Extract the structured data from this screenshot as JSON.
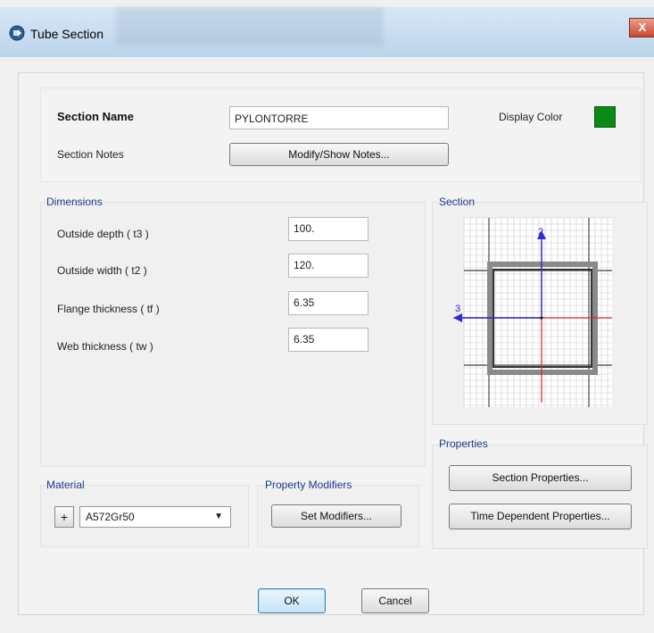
{
  "window": {
    "title": "Tube Section",
    "close_glyph": "X"
  },
  "section_name": {
    "label": "Section Name",
    "value": "PYLONTORRE"
  },
  "display_color": {
    "label": "Display Color",
    "color": "#0b8a15"
  },
  "section_notes": {
    "label": "Section Notes",
    "button": "Modify/Show Notes..."
  },
  "dimensions": {
    "title": "Dimensions",
    "rows": [
      {
        "label": "Outside depth  ( t3 )",
        "value": "100."
      },
      {
        "label": "Outside width  ( t2 )",
        "value": "120."
      },
      {
        "label": "Flange thickness  ( tf )",
        "value": "6.35"
      },
      {
        "label": "Web thickness  ( tw )",
        "value": "6.35"
      }
    ]
  },
  "section_preview": {
    "title": "Section",
    "axis2": "2",
    "axis3": "3"
  },
  "properties": {
    "title": "Properties",
    "section_button": "Section Properties...",
    "time_button": "Time Dependent Properties..."
  },
  "material": {
    "title": "Material",
    "plus": "+",
    "value": "A572Gr50",
    "arrow": "▼"
  },
  "modifiers": {
    "title": "Property Modifiers",
    "button": "Set Modifiers..."
  },
  "footer": {
    "ok": "OK",
    "cancel": "Cancel"
  }
}
